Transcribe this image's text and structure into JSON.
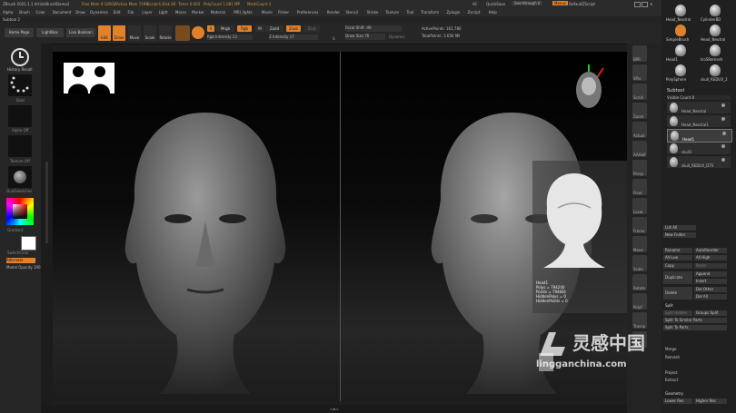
{
  "titlebar": {
    "app_title": "ZBrush 2021.1.1  ArtistsBrushDemo2",
    "free_mem": "Free Mem 9.185GB",
    "active_mem": "Active Mem 7198",
    "scratch_disk": "Scratch Disk 80",
    "timer": "Timer 0.003",
    "poly_count": "PolyCount 1.081 MP",
    "mesh_count": "MeshCount 3",
    "ac": "AC",
    "quicksave": "QuickSave",
    "see_through": "See-through 0",
    "menus_btn": "Menus",
    "default_zscript": "DefaultZScript"
  },
  "menubar": [
    "Alpha",
    "Brush",
    "Color",
    "Document",
    "Draw",
    "Dynamics",
    "Edit",
    "File",
    "Layer",
    "Light",
    "Macro",
    "Marker",
    "Material",
    "MRI_lights",
    "Movie",
    "Picker",
    "Preferences",
    "Render",
    "Stencil",
    "Stroke",
    "Texture",
    "Tool",
    "Transform",
    "Zplugin",
    "Zscript",
    "Help"
  ],
  "subtitle": "Subtool 2",
  "toolbar": {
    "home_page": "Home Page",
    "lightbox": "LightBox",
    "live_boolean": "Live Boolean",
    "edit": "Edit",
    "draw": "Draw",
    "move": "Move",
    "scale": "Scale",
    "rotate": "Rotate",
    "a_label": "A",
    "mrgb": "Mrgb",
    "rgb": "Rgb",
    "m": "M",
    "zadd": "Zadd",
    "zsub": "Zsub",
    "zcut": "Zcut",
    "rgb_intensity": "Rgb Intensity 13",
    "z_intensity": "Z Intensity 17",
    "focal_shift": "Focal Shift -49",
    "draw_size": "Draw Size 76",
    "dynamic": "Dynamic",
    "active_points": "ActivePoints: 161,780",
    "total_points": "TotalPoints: 3.656 Mil"
  },
  "leftshelf": {
    "history_recall": "History Recall",
    "dots": "Dots",
    "alpha_off": "Alpha Off",
    "texture_off": "Texture Off",
    "dual_swatch": "DualSwatches",
    "gradient": "Gradient",
    "switch_color": "SwitchColor",
    "alternate": "Alternate",
    "model_opacity": "Model Opacity 100"
  },
  "canvas": {
    "tooltip": {
      "name": "Head1",
      "polys": "Polys = 794240",
      "points": "Points = 794681",
      "hidden_polys": "HiddenPolys = 0",
      "hidden_points": "HiddenPoints = 0"
    }
  },
  "righttools": [
    "BPR",
    "SPix",
    "Scroll",
    "Zoom",
    "Actual",
    "AAHalf",
    "Persp",
    "Floor",
    "Local",
    "Frame",
    "Move",
    "Scale",
    "Rotate",
    "PolyF",
    "Transp",
    "Solo"
  ],
  "rightpanel": {
    "tool_thumbs": [
      {
        "label": "Head_Neutral"
      },
      {
        "label": "CylinderBD"
      },
      {
        "label": "SimpleBrush"
      },
      {
        "label": "Head_Neutral"
      },
      {
        "label": "Head1"
      },
      {
        "label": "IcoSRemesh"
      },
      {
        "label": "PolySphere"
      },
      {
        "label": "skull_REDUX_2"
      }
    ],
    "subtool_header": "Subtool",
    "visible_count": "Visible Count 8",
    "subtools": [
      "Head_Neutral",
      "Head_Neutral1",
      "Head1",
      "skull1",
      "skull_REDUX_DTS"
    ],
    "list_all": "List All",
    "new_folder": "New Folder",
    "rename": "Rename",
    "auto_reorder": "AutoReorder",
    "all_low": "All Low",
    "all_high": "All High",
    "copy": "Copy",
    "paste": "Paste",
    "duplicate": "Duplicate",
    "append": "Append",
    "insert": "Insert",
    "delete": "Delete",
    "del_other": "Del Other",
    "del_all": "Del All",
    "split": "Split",
    "split_hidden": "Split Hidden",
    "groups_split": "Groups Split",
    "split_similar": "Split To Similar Parts",
    "split_parts": "Split To Parts",
    "merge": "Merge",
    "remesh": "Remesh",
    "project": "Project",
    "extract": "Extract",
    "geometry": "Geometry",
    "lower_res": "Lower Res",
    "higher_res": "Higher Res"
  },
  "watermark": {
    "cn": "灵感中国",
    "url": "lingganchina.com"
  }
}
